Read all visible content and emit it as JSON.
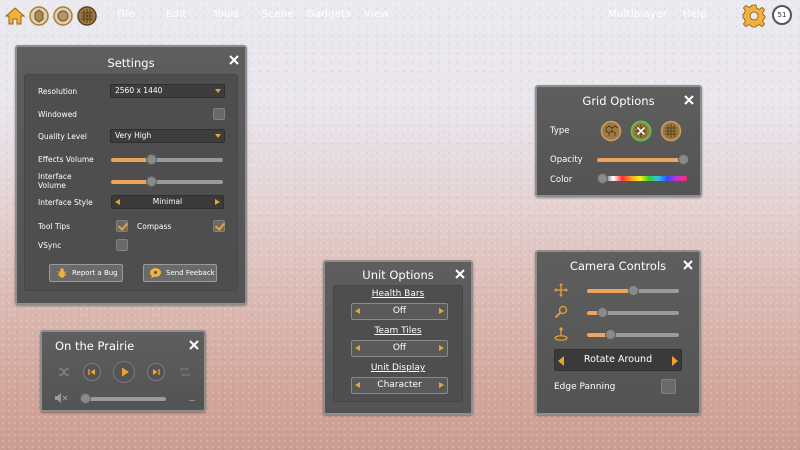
{
  "menu": {
    "file": "File",
    "edit": "Edit",
    "tools": "Tools",
    "scene": "Scene",
    "gadgets": "Gadgets",
    "view": "View",
    "multiplayer": "Multiplayer",
    "help": "Help",
    "fps": "51"
  },
  "settings": {
    "title": "Settings",
    "resolution_label": "Resolution",
    "resolution_value": "2560 x 1440",
    "windowed_label": "Windowed",
    "windowed_checked": false,
    "quality_label": "Quality Level",
    "quality_value": "Very High",
    "effects_volume_label": "Effects Volume",
    "effects_volume": 0.35,
    "interface_volume_label": "Interface\nVolume",
    "interface_volume": 0.35,
    "interface_style_label": "Interface Style",
    "interface_style_value": "Minimal",
    "tooltips_label": "Tool Tips",
    "tooltips_checked": true,
    "compass_label": "Compass",
    "compass_checked": true,
    "vsync_label": "VSync",
    "vsync_checked": false,
    "report_bug_label": "Report a Bug",
    "send_feedback_label": "Send Feeback"
  },
  "music": {
    "title": "On the Prairie",
    "volume": 0.0
  },
  "unit_options": {
    "title": "Unit  Options",
    "health_bars_label": "Health Bars",
    "health_bars_value": "Off",
    "team_tiles_label": "Team Tiles",
    "team_tiles_value": "Off",
    "unit_display_label": "Unit Display",
    "unit_display_value": "Character"
  },
  "grid_options": {
    "title": "Grid  Options",
    "type_label": "Type",
    "opacity_label": "Opacity",
    "opacity": 1.0,
    "color_label": "Color",
    "color": 0.0
  },
  "camera_controls": {
    "title": "Camera  Controls",
    "pan_speed": 0.5,
    "zoom_speed": 0.12,
    "rotate_speed": 0.22,
    "mode_value": "Rotate Around",
    "edge_panning_label": "Edge Panning",
    "edge_panning_checked": false
  },
  "colors": {
    "accent": "#f0a030",
    "panel": "#5a5a5a",
    "slider_fill": "#f2a35a"
  }
}
